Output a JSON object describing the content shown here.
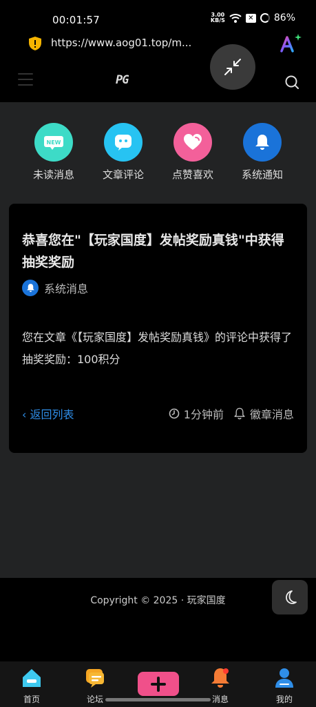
{
  "status_bar": {
    "time": "00:01:57",
    "net_speed_value": "3.00",
    "net_speed_unit": "KB/S",
    "battery": "86%"
  },
  "browser": {
    "url": "https://www.aog01.top/m..."
  },
  "site": {
    "logo_text": "PG"
  },
  "categories": [
    {
      "label": "未读消息",
      "icon": "new-badge-icon",
      "color": "#3ddbc7"
    },
    {
      "label": "文章评论",
      "icon": "chat-face-icon",
      "color": "#27c3f2"
    },
    {
      "label": "点赞喜欢",
      "icon": "heart-icon",
      "color": "#f3609a"
    },
    {
      "label": "系统通知",
      "icon": "bell-icon",
      "color": "#1a73d9"
    }
  ],
  "message": {
    "title": "恭喜您在\"【玩家国度】发帖奖励真钱\"中获得抽奖奖励",
    "source": "系统消息",
    "body": "您在文章《【玩家国度】发帖奖励真钱》的评论中获得了抽奖奖励：100积分",
    "back_label": "返回列表",
    "time": "1分钟前",
    "type": "徽章消息"
  },
  "footer": {
    "copyright": "Copyright © 2025 · 玩家国度"
  },
  "tabbar": {
    "home": "首页",
    "forum": "论坛",
    "messages": "消息",
    "mine": "我的"
  }
}
